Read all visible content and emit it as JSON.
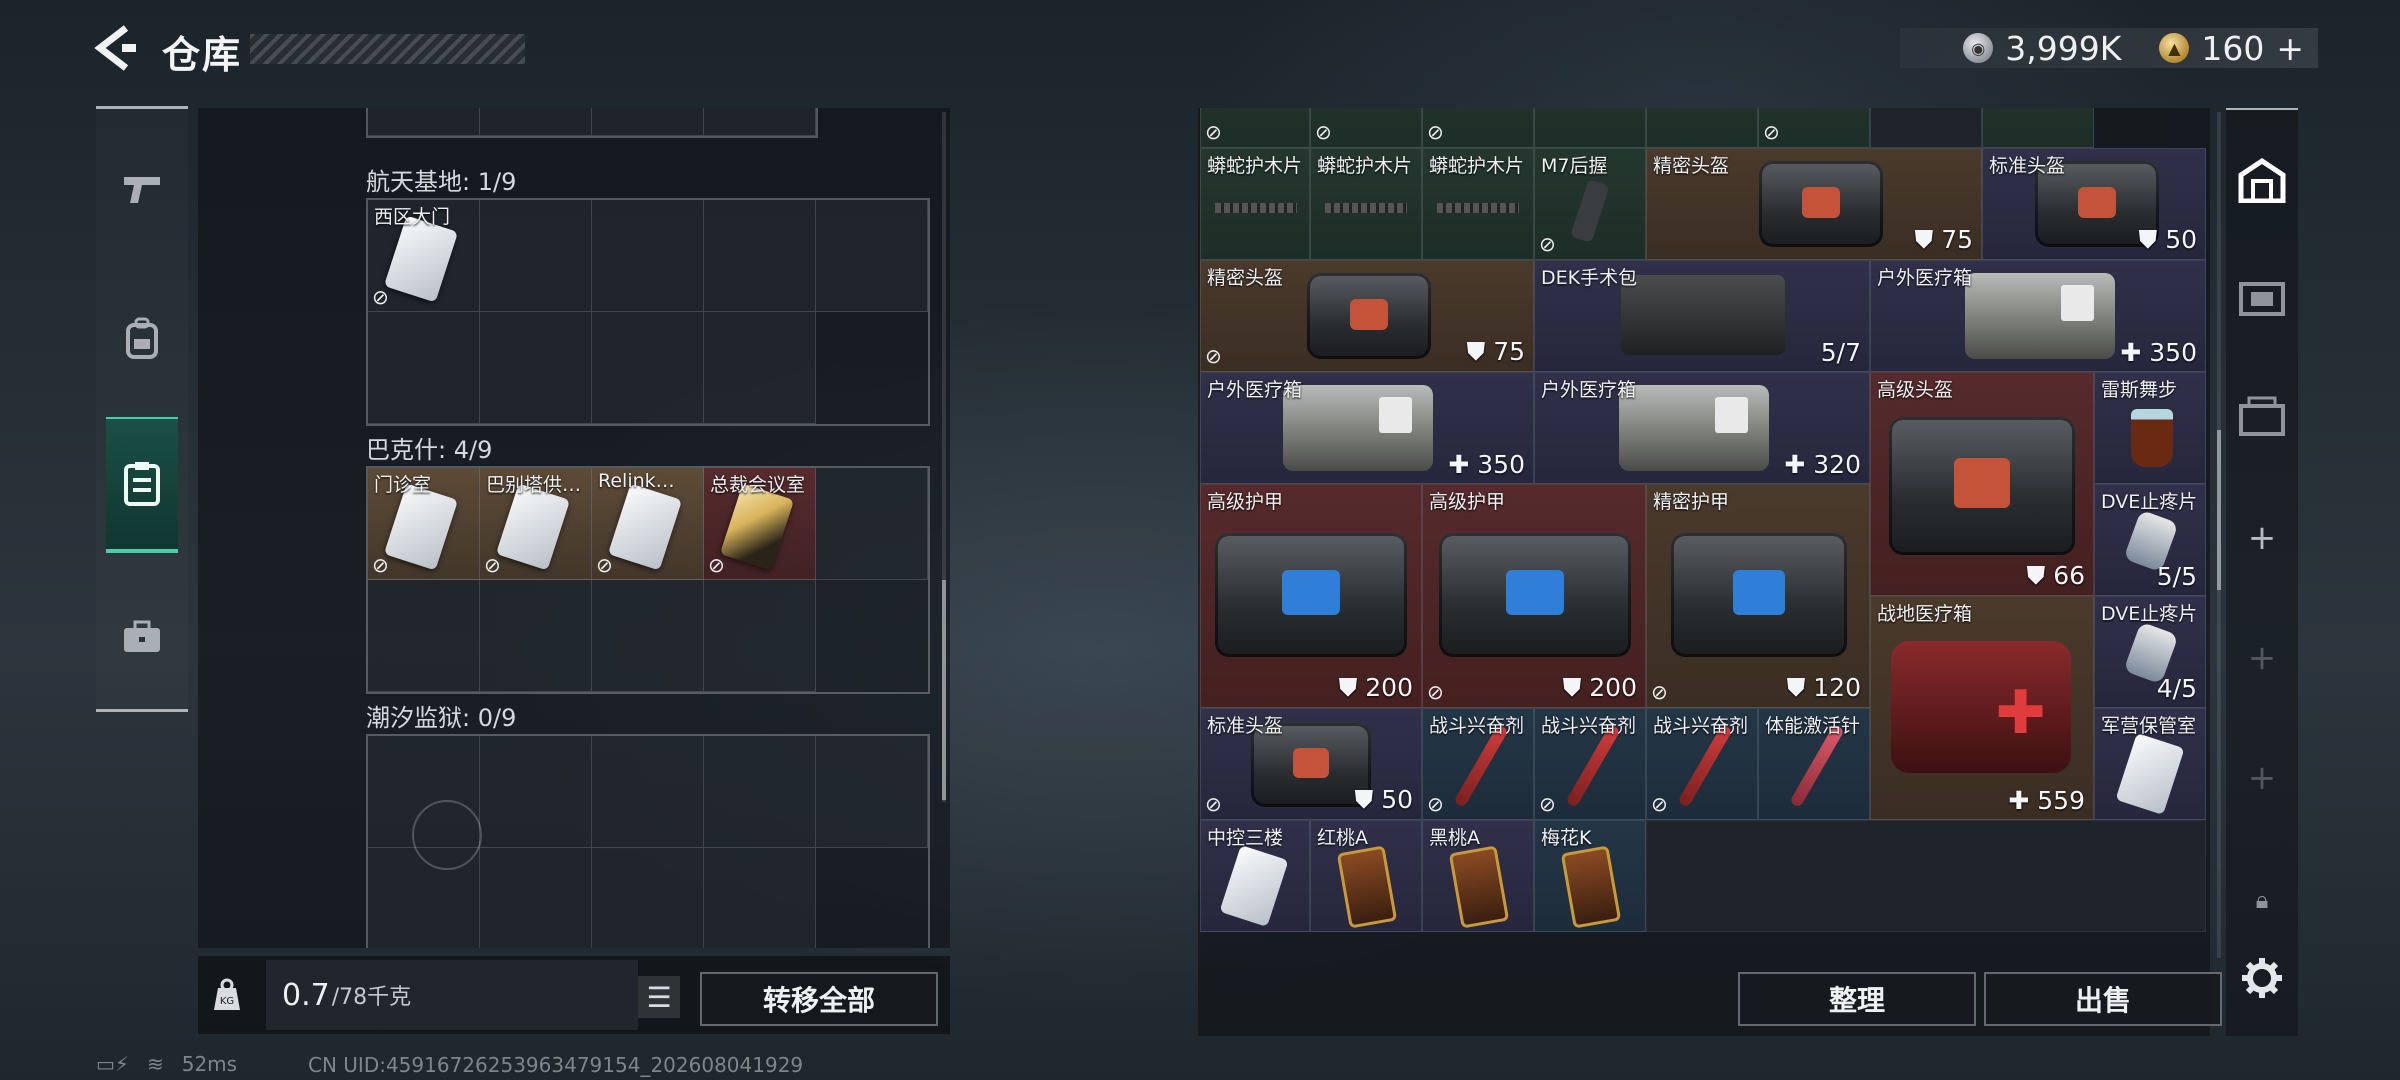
{
  "header": {
    "title": "仓库",
    "currency": [
      {
        "icon": "silver-coin-icon",
        "value": "3,999K"
      },
      {
        "icon": "gold-coin-icon",
        "value": "160",
        "suffix": "+"
      }
    ]
  },
  "left_nav": [
    "pistol-icon",
    "backpack-icon",
    "vest-icon",
    "briefcase-icon"
  ],
  "key_sections": [
    {
      "label": "航天基地: 1/9",
      "cards": [
        "西区大门"
      ]
    },
    {
      "label": "巴克什: 4/9",
      "cards": [
        "门诊室",
        "巴别塔供…",
        "Relink…",
        "总裁会议室"
      ]
    },
    {
      "label": "潮汐监狱: 0/9",
      "cards": []
    }
  ],
  "left_footer": {
    "weight_value": "0.7",
    "weight_capacity": "/78千克",
    "transfer_all": "转移全部"
  },
  "inventory": {
    "r1": [
      "蟒蛇护木片",
      "蟒蛇护木片",
      "蟒蛇护木片",
      "M7后握",
      "精密头盔",
      "标准头盔"
    ],
    "r1_vals": [
      "75",
      "50"
    ],
    "r2": [
      "精密头盔",
      "DEK手术包",
      "户外医疗箱"
    ],
    "r2_vals": [
      "75",
      "5/7",
      "350"
    ],
    "r3": [
      "户外医疗箱",
      "户外医疗箱",
      "高级头盔",
      "雷斯舞步"
    ],
    "r3_vals": [
      "350",
      "320",
      "66"
    ],
    "r4": [
      "高级护甲",
      "高级护甲",
      "精密护甲",
      "DVE止疼片"
    ],
    "r4_vals": [
      "200",
      "200",
      "120",
      "5/5"
    ],
    "r5": [
      "战地医疗箱",
      "DVE止疼片"
    ],
    "r5_vals": [
      "559",
      "4/5"
    ],
    "r6": [
      "标准头盔",
      "战斗兴奋剂",
      "战斗兴奋剂",
      "战斗兴奋剂",
      "体能激活针",
      "军营保管室"
    ],
    "r6_vals": [
      "50"
    ],
    "r7": [
      "中控三楼",
      "红桃A",
      "黑桃A",
      "梅花K"
    ]
  },
  "right_footer": {
    "sort": "整理",
    "sell": "出售"
  },
  "status": {
    "ping": "52ms",
    "uid": "CN UID:45916726253963479154_202608041929"
  }
}
